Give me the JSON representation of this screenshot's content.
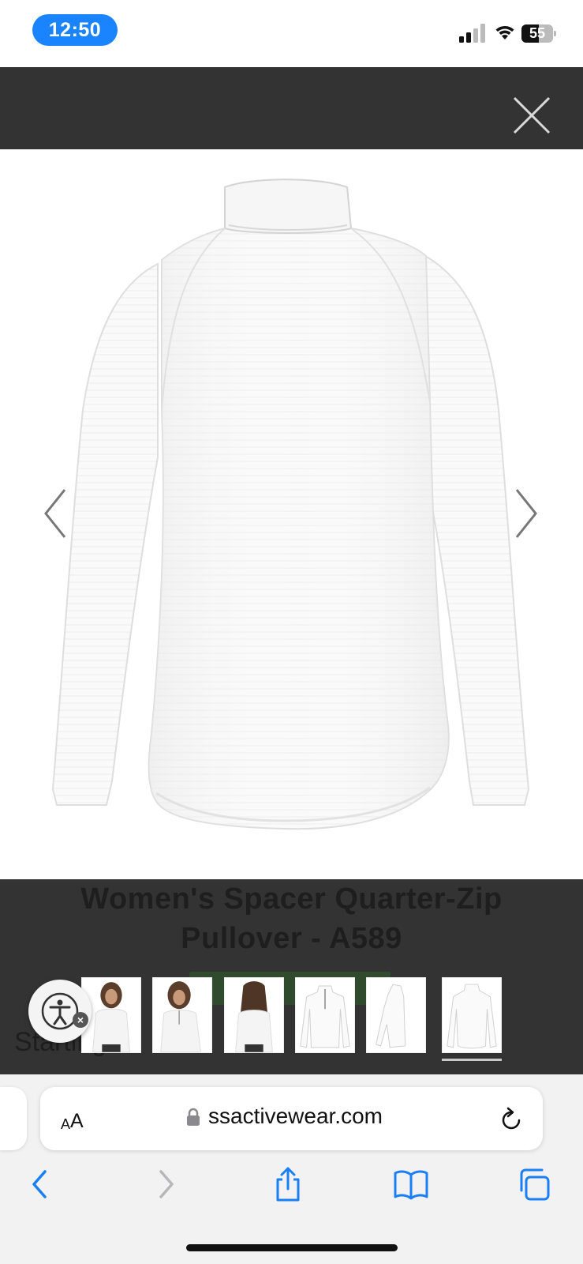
{
  "status_bar": {
    "time": "12:50",
    "battery": "55",
    "battery_level_percent": 55
  },
  "product": {
    "title": "Women's Spacer Quarter-Zip Pullover - A589",
    "button_label": "",
    "starting_text": "Starting at"
  },
  "gallery": {
    "thumbnails": [
      {
        "icon": "model-front-thumbnail"
      },
      {
        "icon": "model-front-closeup-thumbnail"
      },
      {
        "icon": "model-back-thumbnail"
      },
      {
        "icon": "flat-front-thumbnail"
      },
      {
        "icon": "flat-side-thumbnail"
      },
      {
        "icon": "flat-back-thumbnail"
      }
    ],
    "selected_index": 5
  },
  "browser": {
    "text_size_small": "A",
    "text_size_large": "A",
    "url": "ssactivewear.com"
  },
  "colors": {
    "overlay": "#333333",
    "accent_blue": "#1a84ff",
    "toolbar_blue": "#1a7ef5",
    "toolbar_disabled": "#b8b8bc"
  }
}
